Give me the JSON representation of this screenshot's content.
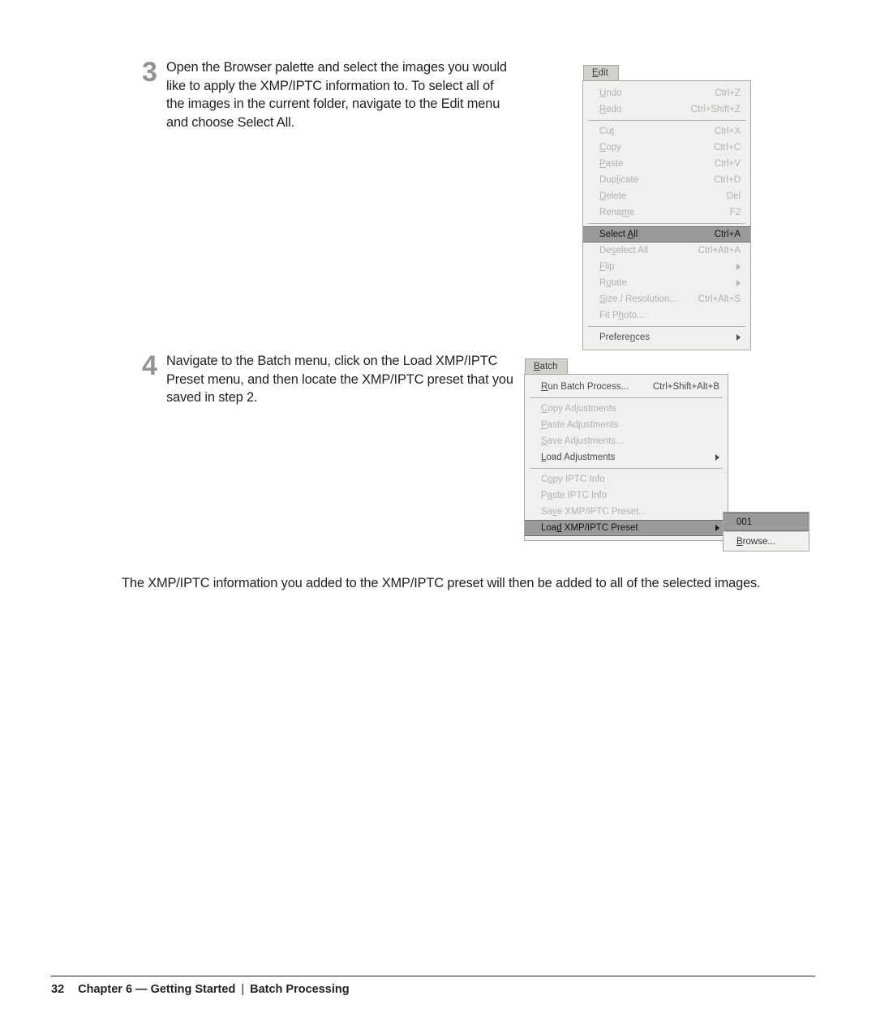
{
  "page": {
    "background": "#ffffff",
    "text_color": "#231f20",
    "step_number_color": "#939393",
    "menu_face_color": "#f1f0ee",
    "menu_tab_color": "#d2d0cd",
    "menu_border_color": "#a9a7a4",
    "menu_highlight_color": "#9c9a98",
    "menu_disabled_text_color": "#b3b1af",
    "menu_enabled_text_color": "#4a4a4a"
  },
  "steps": [
    {
      "number": "3",
      "text": "Open the Browser palette and select the images you would like to apply the XMP/IPTC information to. To select all of the images in the current folder, navigate to the Edit menu and choose Select All."
    },
    {
      "number": "4",
      "text": "Navigate to the Batch menu, click on the Load XMP/IPTC Preset menu, and then locate the XMP/IPTC preset that you saved in step 2."
    }
  ],
  "edit_menu": {
    "tab_label": "Edit",
    "tab_mnemonic": "E",
    "items": [
      {
        "label": "Undo",
        "mnemonic": "U",
        "accel": "Ctrl+Z",
        "enabled": false,
        "submenu": false
      },
      {
        "label": "Redo",
        "mnemonic": "R",
        "accel": "Ctrl+Shift+Z",
        "enabled": false,
        "submenu": false
      },
      {
        "separator": true
      },
      {
        "label": "Cut",
        "mnemonic": "t",
        "accel": "Ctrl+X",
        "enabled": false,
        "submenu": false
      },
      {
        "label": "Copy",
        "mnemonic": "C",
        "accel": "Ctrl+C",
        "enabled": false,
        "submenu": false
      },
      {
        "label": "Paste",
        "mnemonic": "P",
        "accel": "Ctrl+V",
        "enabled": false,
        "submenu": false
      },
      {
        "label": "Duplicate",
        "mnemonic": "l",
        "accel": "Ctrl+D",
        "enabled": false,
        "submenu": false
      },
      {
        "label": "Delete",
        "mnemonic": "D",
        "accel": "Del",
        "enabled": false,
        "submenu": false
      },
      {
        "label": "Rename",
        "mnemonic": "m",
        "accel": "F2",
        "enabled": false,
        "submenu": false
      },
      {
        "separator": true
      },
      {
        "label": "Select All",
        "mnemonic": "A",
        "accel": "Ctrl+A",
        "enabled": true,
        "selected": true,
        "submenu": false
      },
      {
        "label": "Deselect All",
        "mnemonic": "s",
        "accel": "Ctrl+Alt+A",
        "enabled": false,
        "submenu": false
      },
      {
        "label": "Flip",
        "mnemonic": "F",
        "accel": "",
        "enabled": false,
        "submenu": true
      },
      {
        "label": "Rotate",
        "mnemonic": "o",
        "accel": "",
        "enabled": false,
        "submenu": true
      },
      {
        "label": "Size / Resolution...",
        "mnemonic": "S",
        "accel": "Ctrl+Alt+S",
        "enabled": false,
        "submenu": false
      },
      {
        "label": "Fit Photo...",
        "mnemonic": "h",
        "accel": "",
        "enabled": false,
        "submenu": false
      },
      {
        "separator": true
      },
      {
        "label": "Preferences",
        "mnemonic": "n",
        "accel": "",
        "enabled": true,
        "submenu": true
      }
    ]
  },
  "batch_menu": {
    "tab_label": "Batch",
    "tab_mnemonic": "B",
    "items": [
      {
        "label": "Run Batch Process...",
        "mnemonic": "R",
        "accel": "Ctrl+Shift+Alt+B",
        "enabled": true,
        "submenu": false
      },
      {
        "separator": true
      },
      {
        "label": "Copy Adjustments",
        "mnemonic": "C",
        "accel": "",
        "enabled": false,
        "submenu": false
      },
      {
        "label": "Paste Adjustments",
        "mnemonic": "P",
        "accel": "",
        "enabled": false,
        "submenu": false
      },
      {
        "label": "Save Adjustments...",
        "mnemonic": "S",
        "accel": "",
        "enabled": false,
        "submenu": false
      },
      {
        "label": "Load Adjustments",
        "mnemonic": "L",
        "accel": "",
        "enabled": true,
        "submenu": true
      },
      {
        "separator": true
      },
      {
        "label": "Copy IPTC Info",
        "mnemonic": "o",
        "accel": "",
        "enabled": false,
        "submenu": false
      },
      {
        "label": "Paste IPTC Info",
        "mnemonic": "a",
        "accel": "",
        "enabled": false,
        "submenu": false
      },
      {
        "label": "Save XMP/IPTC Preset...",
        "mnemonic": "v",
        "accel": "",
        "enabled": false,
        "submenu": false
      },
      {
        "label": "Load XMP/IPTC Preset",
        "mnemonic": "d",
        "accel": "",
        "enabled": true,
        "selected": true,
        "submenu": true
      }
    ]
  },
  "preset_submenu": {
    "items": [
      {
        "label": "001",
        "selected": true
      },
      {
        "separator": true
      },
      {
        "label": "Browse...",
        "mnemonic": "B",
        "selected": false
      }
    ]
  },
  "closing_paragraph": "The XMP/IPTC information you added to the XMP/IPTC preset will then be added to all of the selected images.",
  "footer": {
    "page_number": "32",
    "chapter": "Chapter 6 — Getting Started",
    "divider": "|",
    "section": "Batch Processing"
  }
}
